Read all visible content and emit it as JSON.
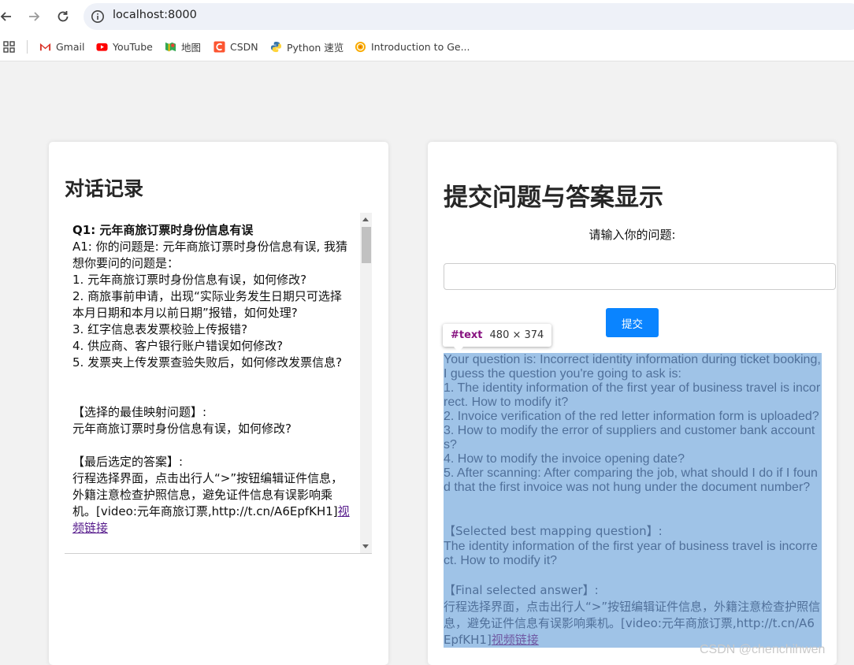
{
  "browser": {
    "url": "localhost:8000",
    "bookmarks": [
      {
        "label": "Gmail",
        "icon": "gmail-icon"
      },
      {
        "label": "YouTube",
        "icon": "youtube-icon"
      },
      {
        "label": "地图",
        "icon": "maps-icon"
      },
      {
        "label": "CSDN",
        "icon": "csdn-icon"
      },
      {
        "label": "Python 速览",
        "icon": "python-icon"
      },
      {
        "label": "Introduction to Ge...",
        "icon": "colab-icon"
      }
    ]
  },
  "left": {
    "title": "对话记录",
    "q1": "Q1: 元年商旅订票时身份信息有误",
    "a1_intro": "A1: 你的问题是: 元年商旅订票时身份信息有误, 我猜想你要问的问题是：",
    "options": [
      "1. 元年商旅订票时身份信息有误，如何修改?",
      "2. 商旅事前申请，出现“实际业务发生日期只可选择本月日期和本月以前日期”报错，如何处理?",
      "3. 红字信息表发票校验上传报错?",
      "4. 供应商、客户银行账户错误如何修改?",
      "5. 发票夹上传发票查验失败后，如何修改发票信息?"
    ],
    "best_heading": "【选择的最佳映射问题】:",
    "best_question": "元年商旅订票时身份信息有误，如何修改?",
    "final_heading": "【最后选定的答案】:",
    "final_answer": "行程选择界面，点击出行人“>”按钮编辑证件信息，外籍注意检查护照信息，避免证件信息有误影响乘机。[video:元年商旅订票,http://t.cn/A6EpfKH1]",
    "video_link": "视频链接"
  },
  "right": {
    "title": "提交问题与答案显示",
    "prompt_label": "请输入你的问题:",
    "input_value": "",
    "submit_label": "提交",
    "tooltip_node": "#text",
    "tooltip_dims": "480 × 374",
    "answer": {
      "intro": "Your question is: Incorrect identity information during ticket booking, I guess the question you're going to ask is:",
      "options": [
        "1. The identity information of the first year of business travel is incorrect. How to modify it?",
        "2. Invoice verification of the red letter information form is uploaded?",
        "3. How to modify the error of suppliers and customer bank accounts?",
        "4. How to modify the invoice opening date?",
        "5. After scanning: After comparing the job, what should I do if I found that the first invoice was not hung under the document number?"
      ],
      "best_heading": "【Selected best mapping question】:",
      "best_question": "The identity information of the first year of business travel is incorrect. How to modify it?",
      "final_heading": "【Final selected answer】:",
      "final_answer": "行程选择界面，点击出行人“>”按钮编辑证件信息，外籍注意检查护照信息，避免证件信息有误影响乘机。[video:元年商旅订票,http://t.cn/A6EpfKH1]",
      "video_link": "视频链接"
    }
  },
  "watermark": "CSDN @chenchihwen"
}
